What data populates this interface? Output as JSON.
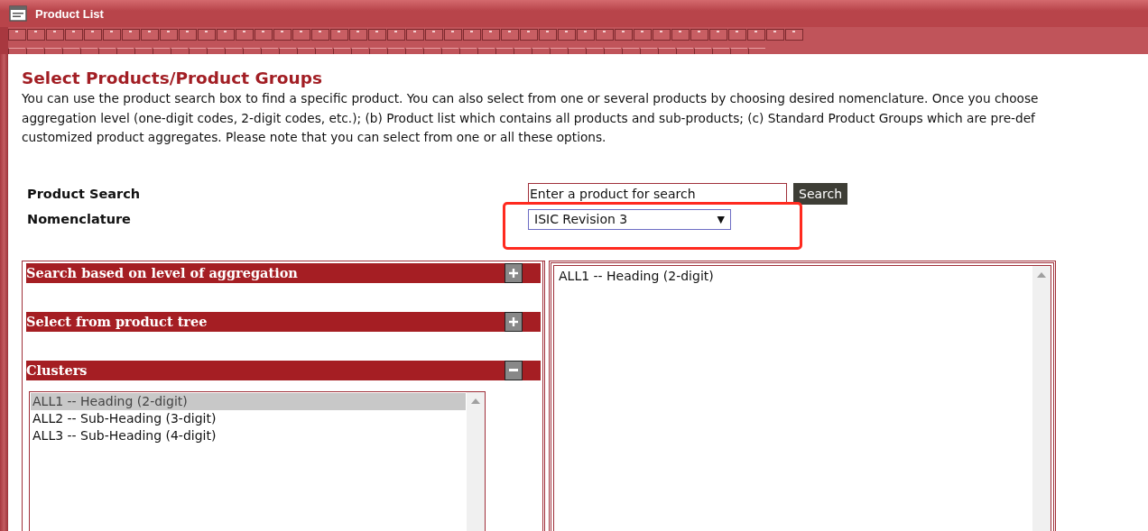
{
  "window": {
    "title": "Product List"
  },
  "heading": "Select Products/Product Groups",
  "intro_lines": [
    "You can use the product search box to find a specific product. You can also select from one or several products by choosing desired nomenclature. Once you choose",
    "aggregation level (one-digit codes, 2-digit codes, etc.); (b) Product list which contains all products and sub-products; (c) Standard Product Groups which are pre-def",
    "customized product aggregates. Please note that you can select from one or all these options."
  ],
  "product_search": {
    "label": "Product Search",
    "placeholder": "Enter a product for search",
    "button": "Search"
  },
  "nomenclature": {
    "label": "Nomenclature",
    "value": "ISIC Revision 3",
    "caret": "▼",
    "highlighted": true
  },
  "sections": [
    {
      "title": "Search based on level of aggregation",
      "expanded": false
    },
    {
      "title": "Select from product tree",
      "expanded": false
    },
    {
      "title": "Clusters",
      "expanded": true
    }
  ],
  "cluster_list": [
    {
      "label": "ALL1 -- Heading (2-digit)",
      "selected": true
    },
    {
      "label": "ALL2 -- Sub-Heading (3-digit)",
      "selected": false
    },
    {
      "label": "ALL3 -- Sub-Heading (4-digit)",
      "selected": false
    }
  ],
  "selected_list": [
    {
      "label": "ALL1 -- Heading (2-digit)"
    }
  ]
}
